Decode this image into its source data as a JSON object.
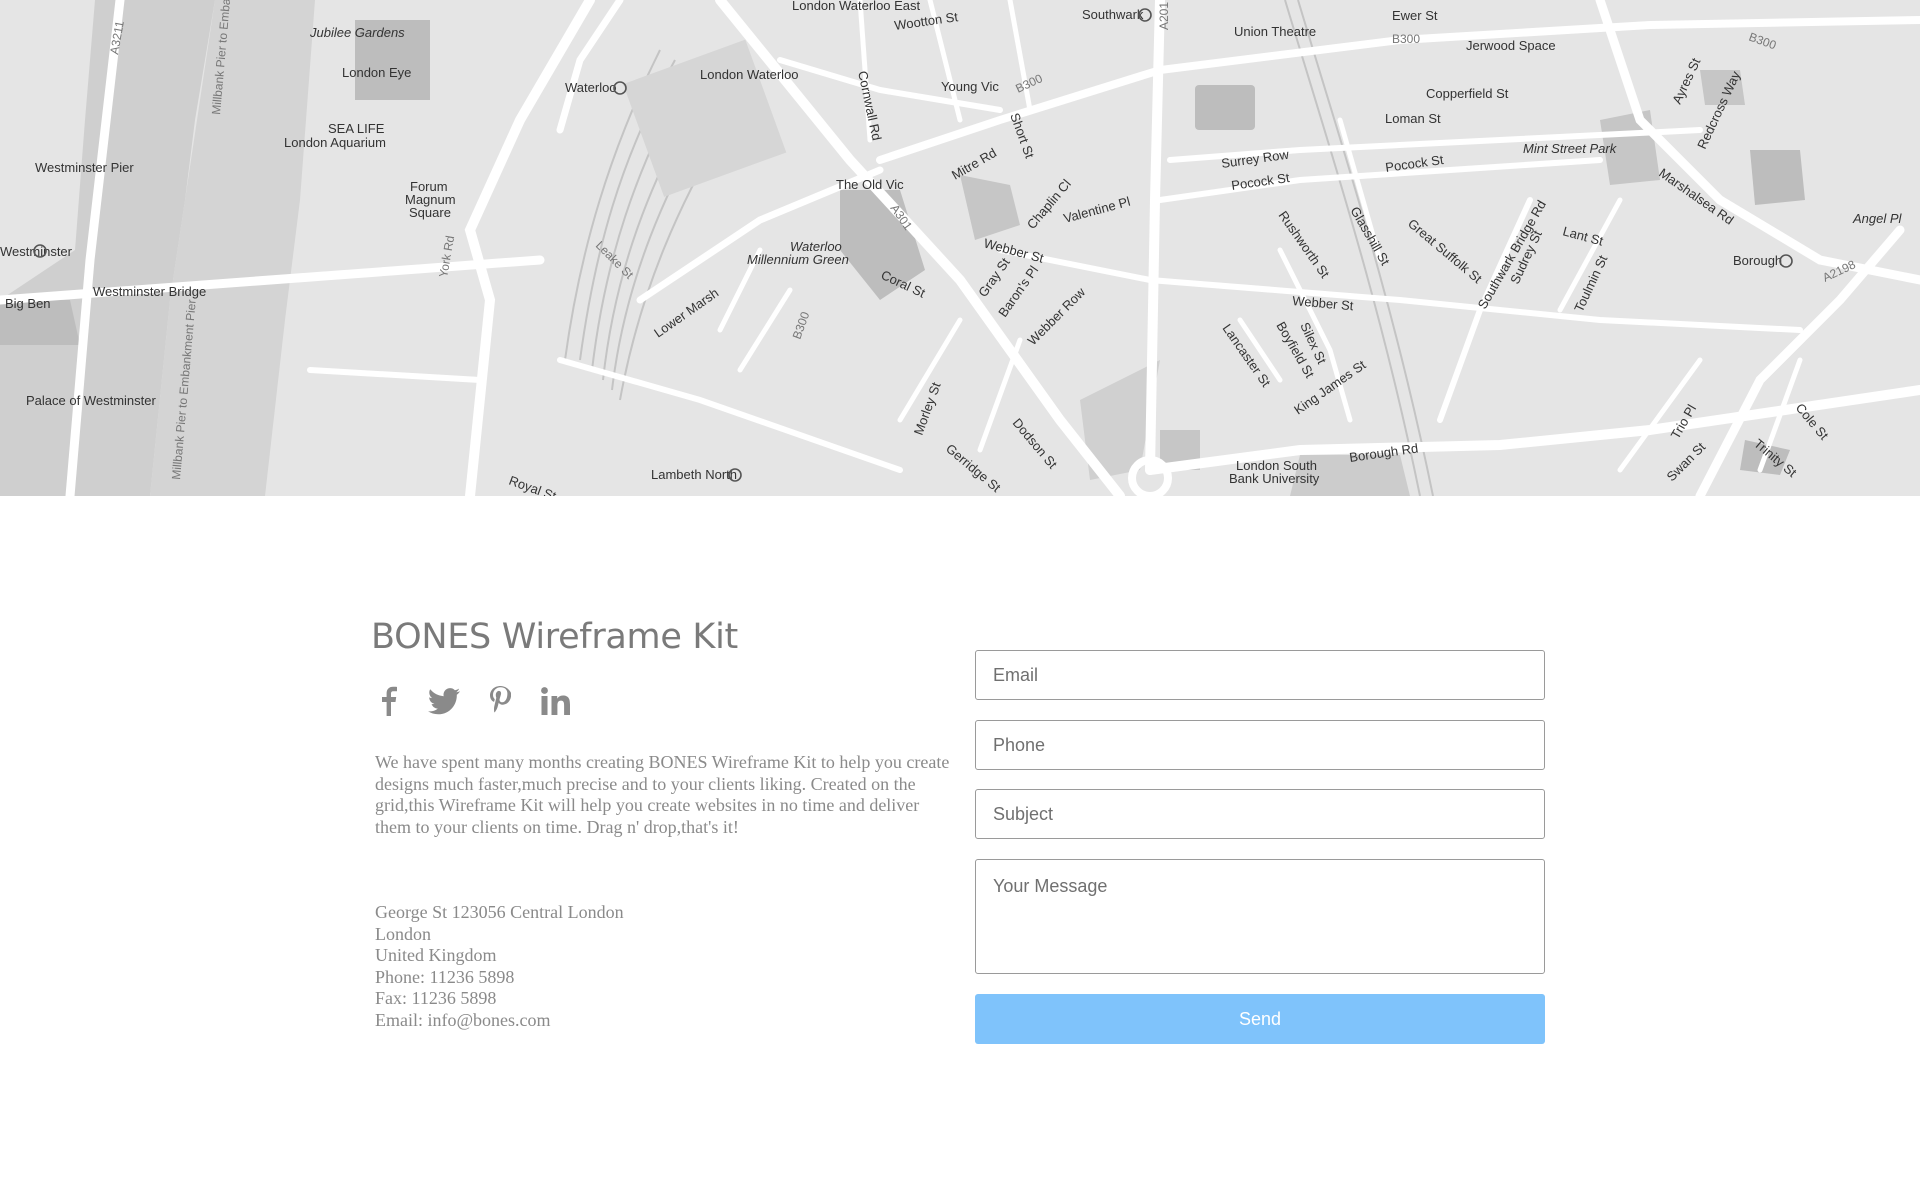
{
  "map": {
    "labels": {
      "london_waterloo_east": "London Waterloo East",
      "wootton_st": "Wootton St",
      "southwark": "Southwark",
      "ewer_st": "Ewer St",
      "union_theatre": "Union Theatre",
      "b300_a": "B300",
      "jerwood_space": "Jerwood Space",
      "b300_b": "B300",
      "jubilee_gardens": "Jubilee Gardens",
      "london_eye": "London Eye",
      "waterloo": "Waterloo",
      "london_waterloo": "London Waterloo",
      "young_vic": "Young Vic",
      "b300_c": "B300",
      "copperfield_st": "Copperfield St",
      "sea_life": "SEA LIFE",
      "london_aquarium": "London Aquarium",
      "loman_st": "Loman St",
      "westminster_pier": "Westminster Pier",
      "forum": "Forum",
      "magnum": "Magnum",
      "square": "Square",
      "the_old_vic": "The Old Vic",
      "mitre_rd": "Mitre Rd",
      "surrey_row": "Surrey Row",
      "pocock_st": "Pocock St",
      "pocock_st_2": "Pocock St",
      "mint_street_park": "Mint Street Park",
      "westminster": "Westminster",
      "waterloo_millennium": "Waterloo",
      "millennium_green": "Millennium Green",
      "webber_st": "Webber St",
      "valentine_pl": "Valentine Pl",
      "chaplin_cl": "Chaplin Cl",
      "rushworth_st": "Rushworth St",
      "glasshill_st": "Glasshill St",
      "great_suffolk_st": "Great Suffolk St",
      "lant_st": "Lant St",
      "borough": "Borough",
      "angel_pl": "Angel Pl",
      "a2198": "A2198",
      "big_ben": "Big Ben",
      "westminster_bridge": "Westminster Bridge",
      "coral_st": "Coral St",
      "webber_st_2": "Webber St",
      "southwark_bridge_rd": "Southwark Bridge Rd",
      "sudrey_st": "Sudrey St",
      "toulmin_st": "Toulmin St",
      "lower_marsh": "Lower Marsh",
      "gray_st": "Gray St",
      "barons_pl": "Baron's Pl",
      "webber_row": "Webber Row",
      "lancaster_st": "Lancaster St",
      "boyfield_st": "Boyfield St",
      "silex_st": "Silex St",
      "king_james_st": "King James St",
      "palace_of_westminster": "Palace of Westminster",
      "cole_st": "Cole St",
      "trio_pl": "Trio Pl",
      "trinity_st": "Trinity St",
      "swan_st": "Swan St",
      "morley_st": "Morley St",
      "dodson_st": "Dodson St",
      "gerridge_st": "Gerridge St",
      "london_south": "London South",
      "bank_university": "Bank University",
      "borough_rd": "Borough Rd",
      "lambeth_north": "Lambeth North",
      "royal_st": "Royal St",
      "cornwall_rd": "Cornwall Rd",
      "short_st": "Short St",
      "a301": "A301",
      "b300_d": "B300",
      "a201": "A201",
      "a3211": "A3211",
      "millbank_pier_1": "Millbank Pier to Embankment",
      "millbank_pier_2": "Millbank Pier to Embankment Pier",
      "leake_st": "Leake St",
      "york_rd": "York Rd",
      "redcross_way": "Redcross Way",
      "ayres_st": "Ayres St",
      "marshalsea_rd": "Marshalsea Rd"
    }
  },
  "contact": {
    "title": "BONES Wireframe Kit",
    "about": "We have spent many months creating BONES Wireframe Kit to help you create designs much faster,much precise and to your clients liking. Created on the grid,this Wireframe Kit will help you create websites in no time and deliver them to your clients on time. Drag n' drop,that's it!",
    "address_lines": [
      "George St 123056 Central London",
      "London",
      "United Kingdom",
      "Phone: 11236 5898",
      "Fax: 11236 5898",
      "Email: info@bones.com"
    ],
    "socials": [
      {
        "icon": "facebook-icon"
      },
      {
        "icon": "twitter-icon"
      },
      {
        "icon": "pinterest-icon"
      },
      {
        "icon": "linkedin-icon"
      }
    ]
  },
  "form": {
    "email_placeholder": "Email",
    "phone_placeholder": "Phone",
    "subject_placeholder": "Subject",
    "message_placeholder": "Your Message",
    "send_label": "Send",
    "send_color": "#7fc3fb"
  },
  "colors": {
    "map_background": "#e5e5e5",
    "text_gray": "#8a8a8a",
    "title_gray": "#7a7a7a"
  }
}
